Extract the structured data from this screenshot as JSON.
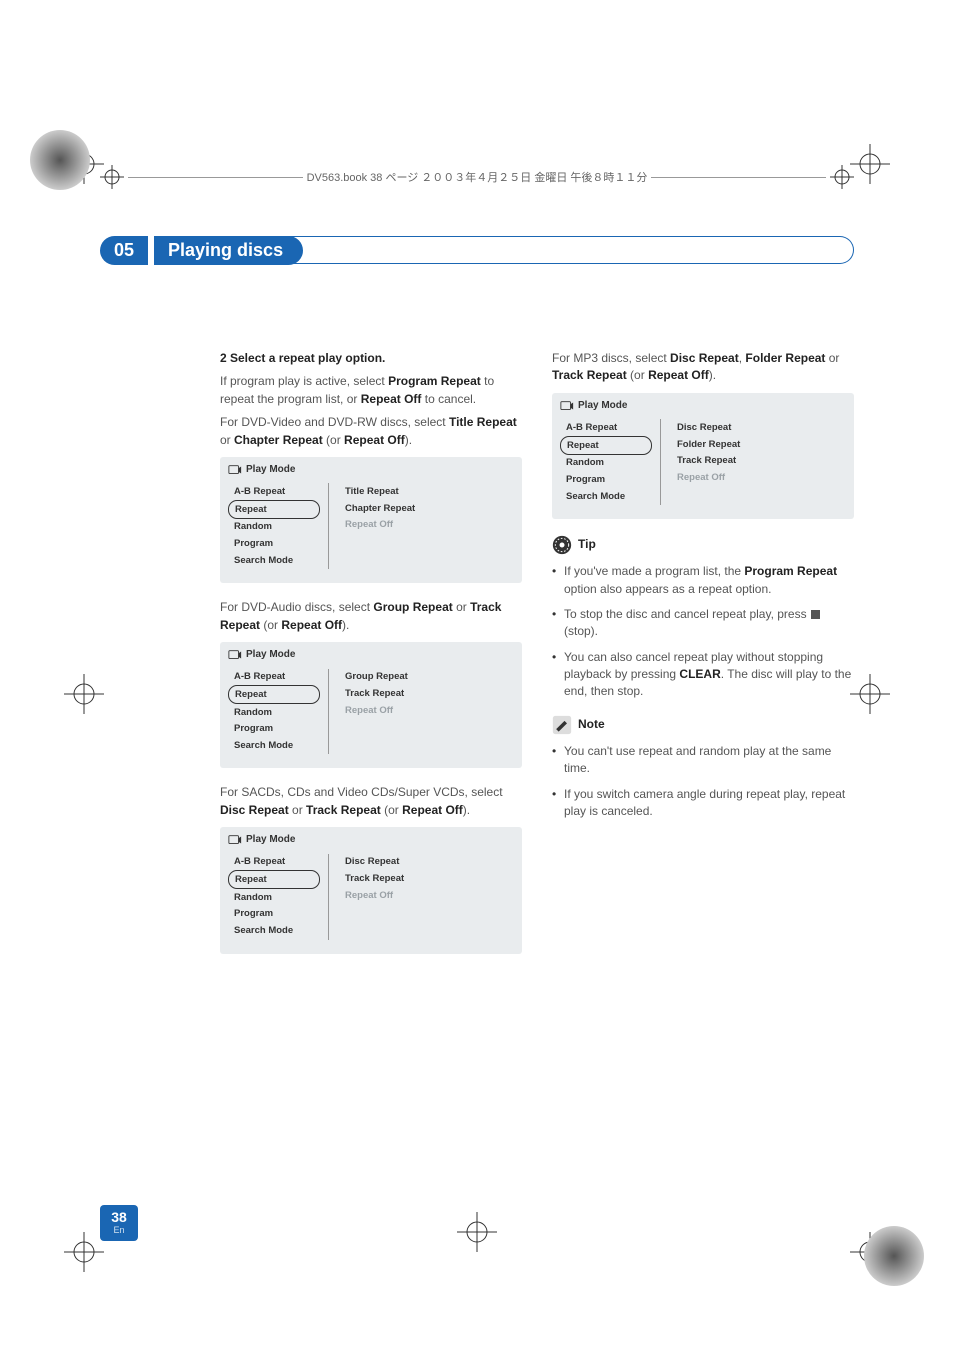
{
  "header_text": "DV563.book 38 ページ ２００３年４月２５日 金曜日 午後８時１１分",
  "chapter": {
    "number": "05",
    "title": "Playing discs"
  },
  "left": {
    "step": "2 Select a repeat play option.",
    "p1a": "If program play is active, select ",
    "p1b": "Program Repeat",
    "p1c": " to repeat the program list, or ",
    "p1d": "Repeat Off",
    "p1e": " to cancel.",
    "p2a": "For DVD-Video and DVD-RW discs, select ",
    "p2b": "Title Repeat",
    "p2c": " or ",
    "p2d": "Chapter Repeat",
    "p2e": " (or ",
    "p2f": "Repeat Off",
    "p2g": ").",
    "p3a": "For DVD-Audio discs, select ",
    "p3b": "Group Repeat",
    "p3c": " or ",
    "p3d": "Track Repeat",
    "p3e": " (or ",
    "p3f": "Repeat Off",
    "p3g": ").",
    "p4a": "For SACDs, CDs and Video CDs/Super VCDs, select ",
    "p4b": "Disc Repeat",
    "p4c": " or ",
    "p4d": "Track Repeat",
    "p4e": " (or ",
    "p4f": "Repeat Off",
    "p4g": ")."
  },
  "right": {
    "p1a": "For MP3 discs, select ",
    "p1b": "Disc Repeat",
    "p1c": ", ",
    "p1d": "Folder Repeat",
    "p1e": " or ",
    "p1f": "Track Repeat",
    "p1g": " (or ",
    "p1h": "Repeat Off",
    "p1i": ").",
    "tip_label": "Tip",
    "tip1a": "If you've made a program list, the ",
    "tip1b": "Program Repeat",
    "tip1c": " option also appears as a repeat option.",
    "tip2a": "To stop the disc and cancel repeat play, press ",
    "tip2b": " (stop).",
    "tip3a": "You can also cancel repeat play without stopping playback by pressing ",
    "tip3b": "CLEAR",
    "tip3c": ". The disc will play to the end, then stop.",
    "note_label": "Note",
    "note1": "You can't use repeat and random play at the same time.",
    "note2": "If you switch camera angle during repeat play, repeat play is canceled."
  },
  "panel": {
    "title": "Play Mode",
    "menu": [
      "A-B Repeat",
      "Repeat",
      "Random",
      "Program",
      "Search Mode"
    ],
    "opts1": [
      "Title Repeat",
      "Chapter Repeat",
      "Repeat Off"
    ],
    "opts2": [
      "Group Repeat",
      "Track Repeat",
      "Repeat Off"
    ],
    "opts3": [
      "Disc Repeat",
      "Track Repeat",
      "Repeat Off"
    ],
    "opts4": [
      "Disc Repeat",
      "Folder Repeat",
      "Track Repeat",
      "Repeat Off"
    ]
  },
  "page": {
    "num": "38",
    "lang": "En"
  }
}
